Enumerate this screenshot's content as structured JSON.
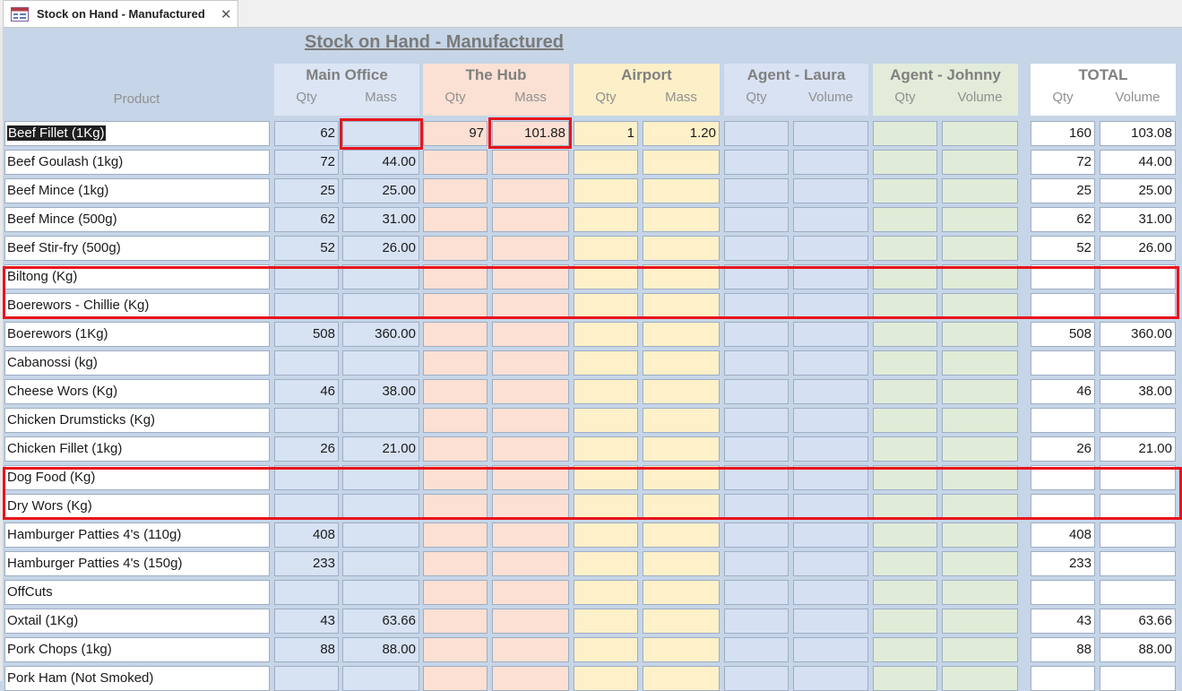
{
  "tab": {
    "title": "Stock on Hand - Manufactured"
  },
  "form": {
    "title": "Stock on Hand - Manufactured",
    "product_label": "Product"
  },
  "groups": [
    {
      "title": "Main Office",
      "sub": [
        "Qty",
        "Mass"
      ]
    },
    {
      "title": "The Hub",
      "sub": [
        "Qty",
        "Mass"
      ]
    },
    {
      "title": "Airport",
      "sub": [
        "Qty",
        "Mass"
      ]
    },
    {
      "title": "Agent - Laura",
      "sub": [
        "Qty",
        "Volume"
      ]
    },
    {
      "title": "Agent - Johnny",
      "sub": [
        "Qty",
        "Volume"
      ]
    },
    {
      "title": "TOTAL",
      "sub": [
        "Qty",
        "Volume"
      ]
    }
  ],
  "rows": [
    {
      "name": "Beef Fillet (1Kg)",
      "v": [
        "62",
        "",
        "97",
        "101.88",
        "1",
        "1.20",
        "",
        "",
        "",
        "",
        "160",
        "103.08"
      ]
    },
    {
      "name": "Beef Goulash (1kg)",
      "v": [
        "72",
        "44.00",
        "",
        "",
        "",
        "",
        "",
        "",
        "",
        "",
        "72",
        "44.00"
      ]
    },
    {
      "name": "Beef Mince (1kg)",
      "v": [
        "25",
        "25.00",
        "",
        "",
        "",
        "",
        "",
        "",
        "",
        "",
        "25",
        "25.00"
      ]
    },
    {
      "name": "Beef Mince (500g)",
      "v": [
        "62",
        "31.00",
        "",
        "",
        "",
        "",
        "",
        "",
        "",
        "",
        "62",
        "31.00"
      ]
    },
    {
      "name": "Beef Stir-fry (500g)",
      "v": [
        "52",
        "26.00",
        "",
        "",
        "",
        "",
        "",
        "",
        "",
        "",
        "52",
        "26.00"
      ]
    },
    {
      "name": "Biltong (Kg)",
      "v": [
        "",
        "",
        "",
        "",
        "",
        "",
        "",
        "",
        "",
        "",
        "",
        ""
      ]
    },
    {
      "name": "Boerewors - Chillie (Kg)",
      "v": [
        "",
        "",
        "",
        "",
        "",
        "",
        "",
        "",
        "",
        "",
        "",
        ""
      ]
    },
    {
      "name": "Boerewors (1Kg)",
      "v": [
        "508",
        "360.00",
        "",
        "",
        "",
        "",
        "",
        "",
        "",
        "",
        "508",
        "360.00"
      ]
    },
    {
      "name": "Cabanossi (kg)",
      "v": [
        "",
        "",
        "",
        "",
        "",
        "",
        "",
        "",
        "",
        "",
        "",
        ""
      ]
    },
    {
      "name": "Cheese Wors (Kg)",
      "v": [
        "46",
        "38.00",
        "",
        "",
        "",
        "",
        "",
        "",
        "",
        "",
        "46",
        "38.00"
      ]
    },
    {
      "name": "Chicken Drumsticks (Kg)",
      "v": [
        "",
        "",
        "",
        "",
        "",
        "",
        "",
        "",
        "",
        "",
        "",
        ""
      ]
    },
    {
      "name": "Chicken Fillet (1kg)",
      "v": [
        "26",
        "21.00",
        "",
        "",
        "",
        "",
        "",
        "",
        "",
        "",
        "26",
        "21.00"
      ]
    },
    {
      "name": "Dog Food (Kg)",
      "v": [
        "",
        "",
        "",
        "",
        "",
        "",
        "",
        "",
        "",
        "",
        "",
        ""
      ]
    },
    {
      "name": "Dry Wors (Kg)",
      "v": [
        "",
        "",
        "",
        "",
        "",
        "",
        "",
        "",
        "",
        "",
        "",
        ""
      ]
    },
    {
      "name": "Hamburger Patties 4's (110g)",
      "v": [
        "408",
        "",
        "",
        "",
        "",
        "",
        "",
        "",
        "",
        "",
        "408",
        ""
      ]
    },
    {
      "name": "Hamburger Patties 4's (150g)",
      "v": [
        "233",
        "",
        "",
        "",
        "",
        "",
        "",
        "",
        "",
        "",
        "233",
        ""
      ]
    },
    {
      "name": "OffCuts",
      "v": [
        "",
        "",
        "",
        "",
        "",
        "",
        "",
        "",
        "",
        "",
        "",
        ""
      ]
    },
    {
      "name": "Oxtail (1Kg)",
      "v": [
        "43",
        "63.66",
        "",
        "",
        "",
        "",
        "",
        "",
        "",
        "",
        "43",
        "63.66"
      ]
    },
    {
      "name": "Pork Chops (1kg)",
      "v": [
        "88",
        "88.00",
        "",
        "",
        "",
        "",
        "",
        "",
        "",
        "",
        "88",
        "88.00"
      ]
    },
    {
      "name": "Pork Ham (Not Smoked)",
      "v": [
        "",
        "",
        "",
        "",
        "",
        "",
        "",
        "",
        "",
        "",
        "",
        ""
      ]
    }
  ],
  "selected_row": 0,
  "colors": {
    "main_office": "#d7e2f3",
    "the_hub": "#fbe0d3",
    "airport": "#fef1c9",
    "agent_laura": "#d6e0f3",
    "agent_johnny": "#e1ecd8",
    "total": "#ffffff",
    "annotation": "#e8141c"
  },
  "icons": {
    "tab_icon": "form-icon",
    "close": "close-icon"
  }
}
